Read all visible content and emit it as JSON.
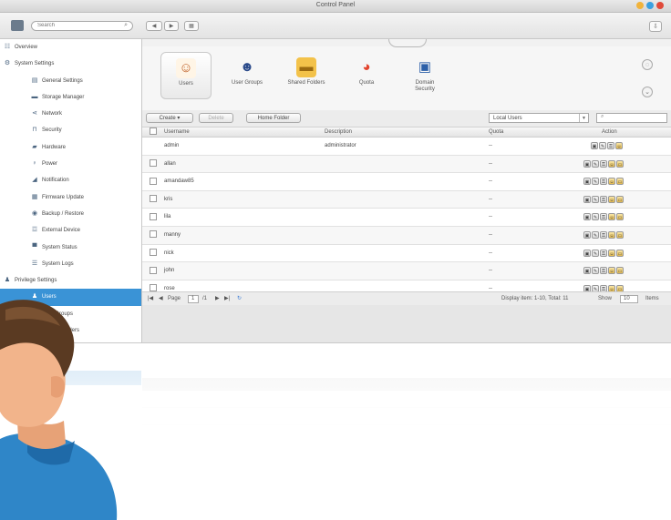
{
  "window": {
    "title": "Control Panel",
    "controls_colors": [
      "#f1b33b",
      "#3aa0e0",
      "#e04a3a"
    ]
  },
  "toolbar": {
    "search_placeholder": "Search",
    "nav_buttons": [
      "◀",
      "▶",
      "▦"
    ]
  },
  "sidebar": {
    "items": [
      {
        "label": "Overview",
        "icon": "tree-icon",
        "level": 0
      },
      {
        "label": "System Settings",
        "icon": "gear-icon",
        "level": 0
      },
      {
        "label": "General Settings",
        "icon": "document-icon",
        "level": 1
      },
      {
        "label": "Storage Manager",
        "icon": "storage-icon",
        "level": 1
      },
      {
        "label": "Network",
        "icon": "network-icon",
        "level": 1
      },
      {
        "label": "Security",
        "icon": "lock-icon",
        "level": 1
      },
      {
        "label": "Hardware",
        "icon": "hardware-icon",
        "level": 1
      },
      {
        "label": "Power",
        "icon": "power-icon",
        "level": 1
      },
      {
        "label": "Notification",
        "icon": "notification-icon",
        "level": 1
      },
      {
        "label": "Firmware Update",
        "icon": "firmware-icon",
        "level": 1
      },
      {
        "label": "Backup / Restore",
        "icon": "backup-icon",
        "level": 1
      },
      {
        "label": "External Device",
        "icon": "usb-icon",
        "level": 1
      },
      {
        "label": "System Status",
        "icon": "monitor-icon",
        "level": 1
      },
      {
        "label": "System Logs",
        "icon": "log-icon",
        "level": 1
      },
      {
        "label": "Privilege Settings",
        "icon": "user-icon",
        "level": 0
      },
      {
        "label": "Users",
        "icon": "users-icon",
        "level": 1,
        "selected": true
      },
      {
        "label": "User Groups",
        "icon": "group-icon",
        "level": 1
      },
      {
        "label": "Shared Folders",
        "icon": "folder-icon",
        "level": 1
      }
    ],
    "selected_color": "#3a93d6"
  },
  "apps": [
    {
      "label": "Users",
      "icon": "user-icon",
      "selected": true
    },
    {
      "label": "User Groups",
      "icon": "group-icon"
    },
    {
      "label": "Shared Folders",
      "icon": "folder-icon"
    },
    {
      "label": "Quota",
      "icon": "quota-icon"
    },
    {
      "label": "Domain Security",
      "icon": "domain-icon"
    }
  ],
  "actions": {
    "create": "Create",
    "delete": "Delete",
    "home_folder": "Home Folder",
    "filter": "Local Users",
    "search_placeholder": ""
  },
  "table": {
    "headers": [
      "Username",
      "Description",
      "Quota",
      "Action"
    ],
    "rows": [
      {
        "username": "admin",
        "description": "administrator",
        "quota": "--"
      },
      {
        "username": "allan",
        "description": "",
        "quota": "--"
      },
      {
        "username": "amandaw85",
        "description": "",
        "quota": "--"
      },
      {
        "username": "kris",
        "description": "",
        "quota": "--"
      },
      {
        "username": "lila",
        "description": "",
        "quota": "--"
      },
      {
        "username": "manny",
        "description": "",
        "quota": "--"
      },
      {
        "username": "nick",
        "description": "",
        "quota": "--"
      },
      {
        "username": "john",
        "description": "",
        "quota": "--"
      },
      {
        "username": "rose",
        "description": "",
        "quota": "--"
      }
    ]
  },
  "pager": {
    "page_label": "Page",
    "page_value": "1",
    "of_label": "/1",
    "display_text": "Display item: 1-10, Total: 11",
    "show_label": "Show",
    "show_value": "10",
    "items_label": "Items"
  }
}
